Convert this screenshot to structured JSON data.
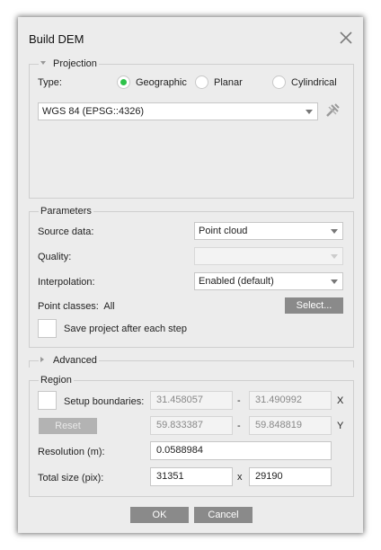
{
  "dialog": {
    "title": "Build DEM"
  },
  "projection": {
    "header": "Projection",
    "type_label": "Type:",
    "options": [
      "Geographic",
      "Planar",
      "Cylindrical"
    ],
    "selected": "Geographic",
    "crs_value": "WGS 84 (EPSG::4326)"
  },
  "parameters": {
    "header": "Parameters",
    "source_label": "Source data:",
    "source_value": "Point cloud",
    "quality_label": "Quality:",
    "quality_value": "",
    "interpolation_label": "Interpolation:",
    "interpolation_value": "Enabled (default)",
    "point_classes_label": "Point classes:",
    "point_classes_value": "All",
    "select_button": "Select...",
    "save_checkbox_label": "Save project after each step"
  },
  "advanced": {
    "header": "Advanced"
  },
  "region": {
    "header": "Region",
    "setup_label": "Setup boundaries:",
    "reset_button": "Reset",
    "x_min": "31.458057",
    "x_max": "31.490992",
    "x_axis": "X",
    "y_min": "59.833387",
    "y_max": "59.848819",
    "y_axis": "Y",
    "dash": "-",
    "resolution_label": "Resolution (m):",
    "resolution_value": "0.0588984",
    "total_size_label": "Total size (pix):",
    "size_x": "31351",
    "size_sep": "x",
    "size_y": "29190"
  },
  "buttons": {
    "ok": "OK",
    "cancel": "Cancel"
  }
}
